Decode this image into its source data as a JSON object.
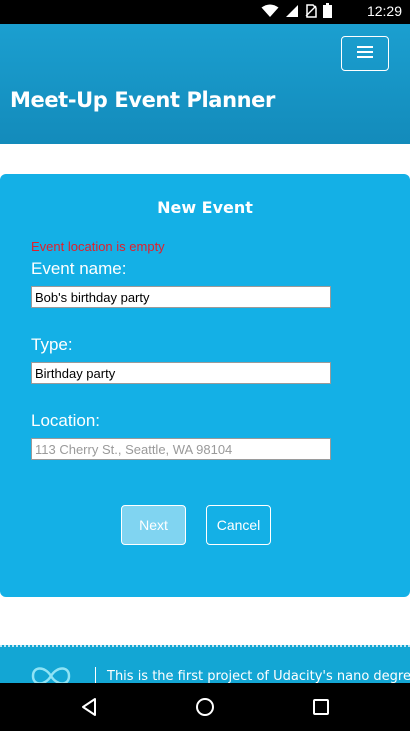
{
  "status_bar": {
    "time": "12:29",
    "icons": [
      "wifi-icon",
      "signal-icon",
      "no-sim-icon",
      "battery-icon"
    ]
  },
  "header": {
    "title": "Meet-Up Event Planner",
    "menu_icon": "hamburger-menu-icon",
    "background": "#1b9fd0"
  },
  "form": {
    "title": "New Event",
    "error": "Event location is empty",
    "fields": [
      {
        "label": "Event name:",
        "value": "Bob's birthday party",
        "placeholder": ""
      },
      {
        "label": "Type:",
        "value": "Birthday party",
        "placeholder": ""
      },
      {
        "label": "Location:",
        "value": "",
        "placeholder": "113 Cherry St., Seattle, WA 98104"
      }
    ],
    "buttons": {
      "next": "Next",
      "cancel": "Cancel"
    },
    "background": "#14b0e6",
    "error_color": "#e0202c"
  },
  "footer": {
    "logo_icon": "infinity-logo-icon",
    "text": "This is the first project of Udacity's nano degree"
  },
  "nav_bar": {
    "icons": [
      "back-icon",
      "home-icon",
      "recents-icon"
    ]
  }
}
